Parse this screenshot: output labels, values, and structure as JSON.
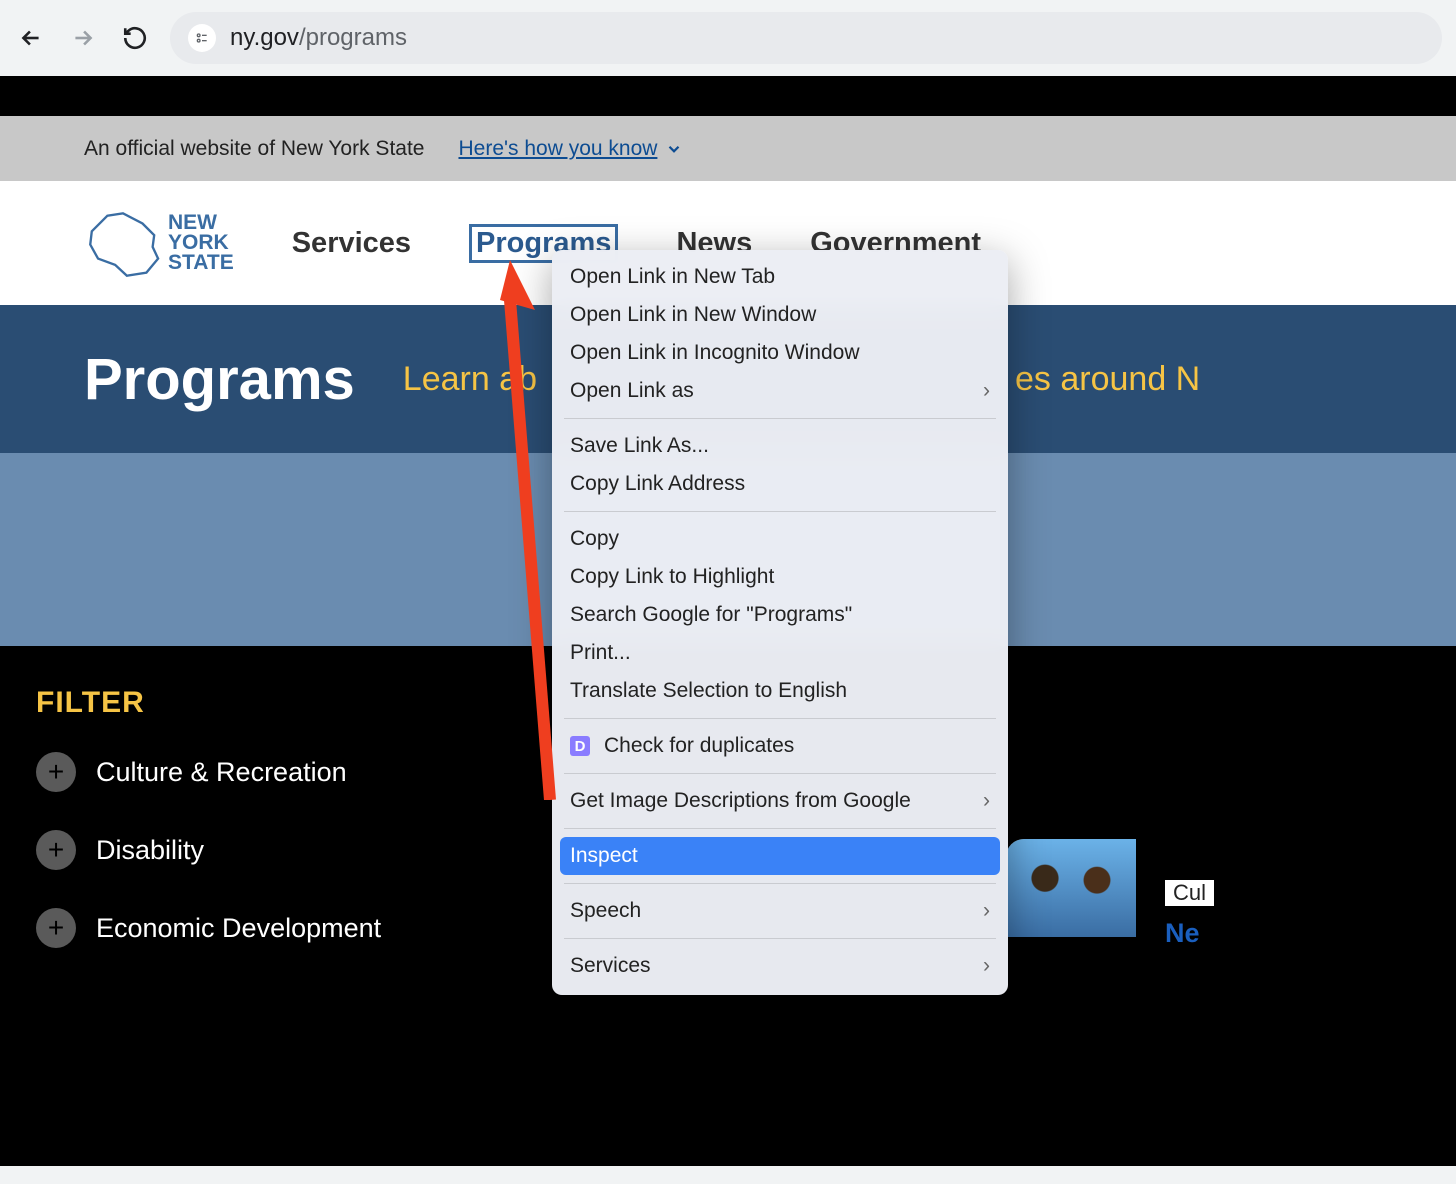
{
  "url": {
    "prefix": "ny.gov",
    "path": "/programs"
  },
  "official_banner": {
    "text": "An official website of New York State",
    "know_link": "Here's how you know"
  },
  "logo_text": {
    "l1": "NEW",
    "l2": "YORK",
    "l3": "STATE"
  },
  "nav": {
    "services": "Services",
    "programs": "Programs",
    "news": "News",
    "government": "Government"
  },
  "hero": {
    "title": "Programs",
    "tagline_before": "Learn ab",
    "tagline_after": "es around N"
  },
  "filter": {
    "title": "FILTER",
    "items": [
      "Culture & Recreation",
      "Disability",
      "Economic Development"
    ]
  },
  "side": {
    "category": "Cul",
    "headline": "Ne"
  },
  "context_menu": {
    "open_tab": "Open Link in New Tab",
    "open_window": "Open Link in New Window",
    "open_incognito": "Open Link in Incognito Window",
    "open_as": "Open Link as",
    "save_as": "Save Link As...",
    "copy_addr": "Copy Link Address",
    "copy": "Copy",
    "copy_highlight": "Copy Link to Highlight",
    "search": "Search Google for \"Programs\"",
    "print": "Print...",
    "translate": "Translate Selection to English",
    "duplicates": "Check for duplicates",
    "img_desc": "Get Image Descriptions from Google",
    "inspect": "Inspect",
    "speech": "Speech",
    "services": "Services"
  }
}
